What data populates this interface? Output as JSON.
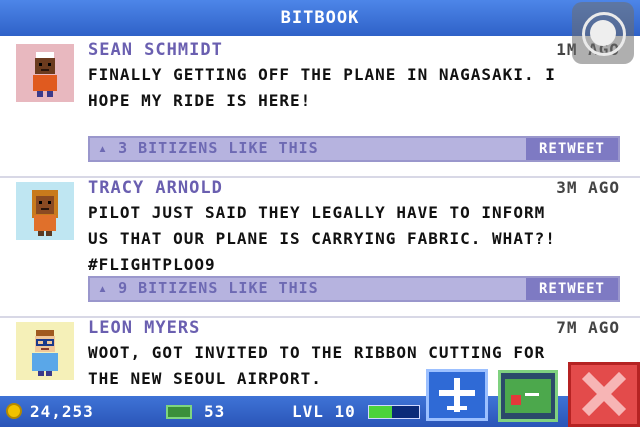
{
  "header": {
    "title": "BITBOOK"
  },
  "posts": [
    {
      "name": "SEAN SCHMIDT",
      "time": "1M AGO",
      "line1": "FINALLY GETTING OFF THE PLANE IN NAGASAKI. I",
      "line2": "HOPE MY RIDE IS HERE!",
      "line3": "",
      "likes": "3 BITIZENS LIKE THIS",
      "retweet": "RETWEET",
      "avatar_bg": "#e8b8bf"
    },
    {
      "name": "TRACY ARNOLD",
      "time": "3M AGO",
      "line1": "PILOT JUST SAID THEY LEGALLY HAVE TO INFORM",
      "line2": "US THAT OUR PLANE IS CARRYING FABRIC. WHAT?!",
      "line3": "#FLIGHTPLOO9",
      "likes": "9 BITIZENS LIKE THIS",
      "retweet": "RETWEET",
      "avatar_bg": "#bfe6f2"
    },
    {
      "name": "LEON MYERS",
      "time": "7M AGO",
      "line1": "WOOT, GOT INVITED TO THE RIBBON CUTTING FOR",
      "line2": "THE NEW SEOUL AIRPORT.",
      "line3": "",
      "avatar_bg": "#f5f0b8"
    }
  ],
  "status": {
    "coins": "24,253",
    "bux": "53",
    "level": "LVL 10",
    "level_progress": 0.45
  },
  "buttons": {
    "plane_icon": "plane-icon",
    "map_icon": "map-icon",
    "close_icon": "close-icon"
  },
  "colors": {
    "accent": "#2f62c8",
    "name": "#6a5fb0",
    "likebar": "#b6b3df",
    "retweet": "#7e7ac3",
    "close": "#e34b4b"
  }
}
